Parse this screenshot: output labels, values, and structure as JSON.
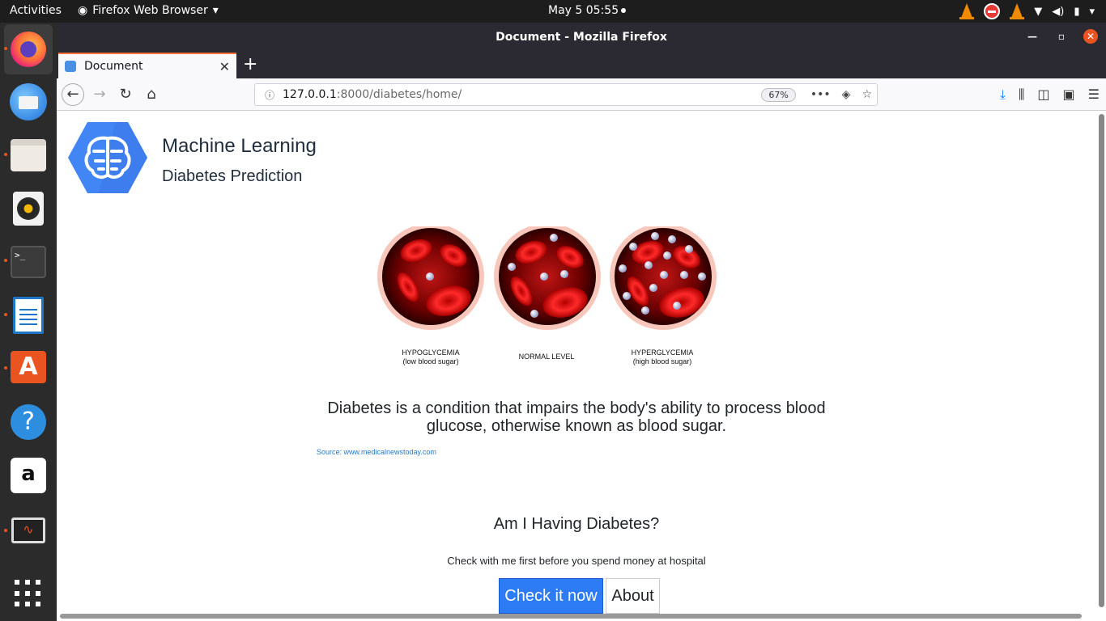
{
  "topbar": {
    "activities": "Activities",
    "app_name": "Firefox Web Browser",
    "clock": "May 5  05:55"
  },
  "window": {
    "title": "Document - Mozilla Firefox"
  },
  "tabs": [
    {
      "label": "Document"
    }
  ],
  "navbar": {
    "url_host": "127.0.0.1",
    "url_rest": ":8000/diabetes/home/",
    "zoom": "67%"
  },
  "page": {
    "brand_title": "Machine Learning",
    "brand_subtitle": "Diabetes Prediction",
    "cells": [
      {
        "caption_line1": "HYPOGLYCEMIA",
        "caption_line2": "(low blood sugar)"
      },
      {
        "caption_line1": "NORMAL LEVEL",
        "caption_line2": ""
      },
      {
        "caption_line1": "HYPERGLYCEMIA",
        "caption_line2": "(high blood sugar)"
      }
    ],
    "description": "Diabetes is a condition that impairs the body's ability to process blood glucose, otherwise known as blood sugar.",
    "source": "Source: www.medicalnewstoday.com",
    "question": "Am I Having Diabetes?",
    "tagline": "Check with me first before you spend money at hospital",
    "check_button": "Check it now",
    "about_button": "About"
  },
  "colors": {
    "primary_button": "#2d7cf6",
    "logo_blue": "#4285f4",
    "ubuntu_orange": "#e95420"
  }
}
